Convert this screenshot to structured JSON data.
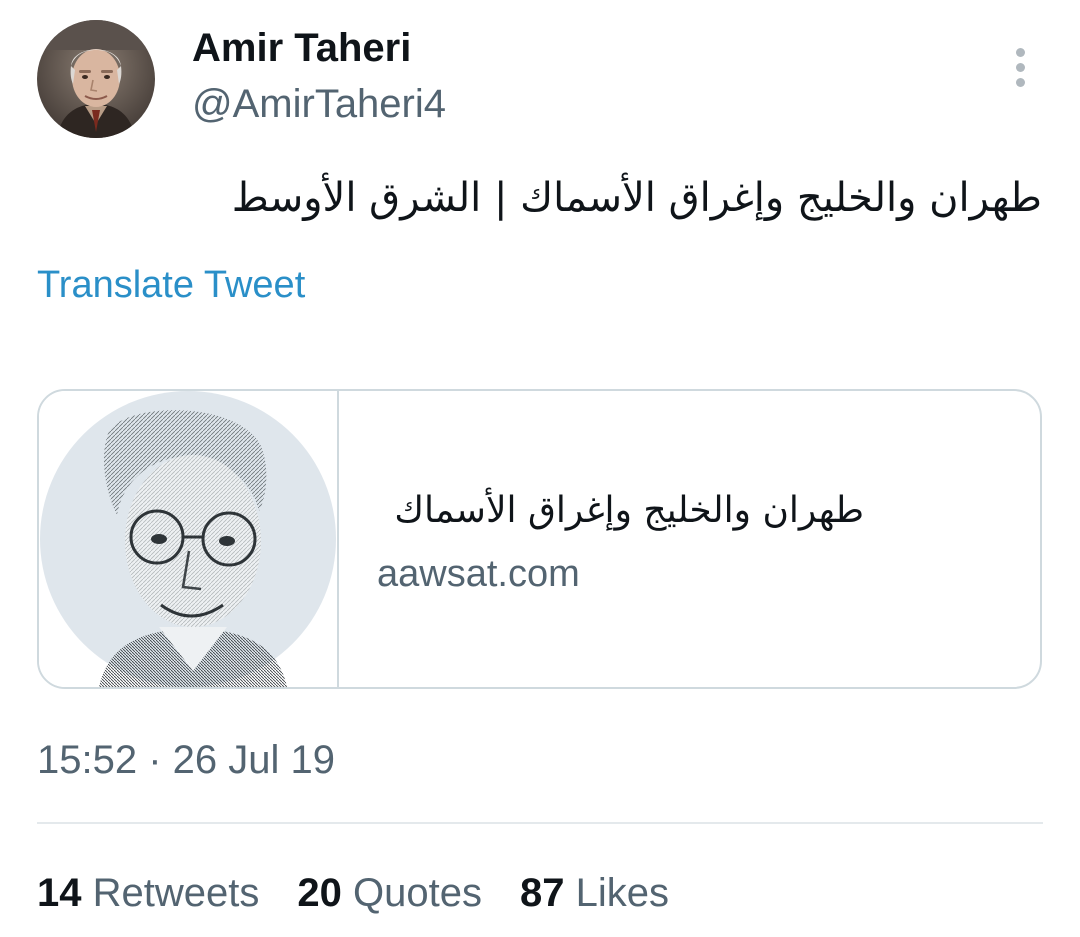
{
  "author": {
    "display_name": "Amir Taheri",
    "handle": "@AmirTaheri4"
  },
  "tweet": {
    "text": "طهران والخليج وإغراق الأسماك | الشرق الأوسط",
    "translate_label": "Translate Tweet",
    "timestamp": "15:52 · 26 Jul 19"
  },
  "link_card": {
    "title": "طهران والخليج وإغراق الأسماك",
    "domain": "aawsat.com"
  },
  "stats": {
    "retweets": {
      "count": "14",
      "label": "Retweets"
    },
    "quotes": {
      "count": "20",
      "label": "Quotes"
    },
    "likes": {
      "count": "87",
      "label": "Likes"
    }
  },
  "icons": {
    "more_menu": "vertical-ellipsis-icon"
  },
  "colors": {
    "link_blue": "#2a8fc8",
    "secondary_text": "#536471",
    "primary_text": "#0f1419",
    "border": "#cfd9de"
  }
}
